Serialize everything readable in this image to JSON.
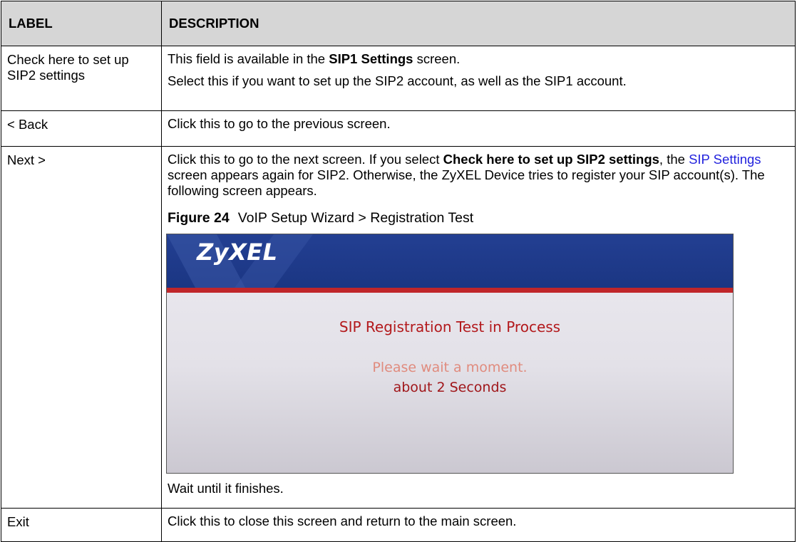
{
  "table": {
    "headers": {
      "label": "LABEL",
      "description": "DESCRIPTION"
    },
    "rows": [
      {
        "label": "Check here to set up SIP2 settings",
        "desc_line1_pre": "This field is available in the ",
        "desc_line1_bold": "SIP1 Settings",
        "desc_line1_post": " screen.",
        "desc_line2": "Select this if you want to set up the SIP2 account, as well as the SIP1 account."
      },
      {
        "label": "< Back",
        "desc": "Click this to go to the previous screen."
      },
      {
        "label": "Next >",
        "desc_pre": "Click this to go to the next screen. If you select ",
        "desc_bold": "Check here to set up SIP2 settings",
        "desc_mid": ", the ",
        "desc_link": "SIP Settings",
        "desc_post": " screen appears again for SIP2. Otherwise, the ZyXEL Device tries to register your SIP account(s). The following screen appears.",
        "figure_number": "Figure 24",
        "figure_title": "VoIP Setup Wizard > Registration Test",
        "after_figure": "Wait until it finishes."
      },
      {
        "label": "Exit",
        "desc": "Click this to close this screen and return to the main screen."
      }
    ]
  },
  "screenshot": {
    "logo_text": "ZyXEL",
    "title": "SIP Registration Test in Process",
    "wait_text": "Please wait a moment.",
    "seconds_text": "about 2 Seconds",
    "colors": {
      "banner": "#233f92",
      "red_rule": "#c0262a",
      "title_red": "#b3191c",
      "wait_pink": "#e08b7e",
      "header_gray": "#d6d6d6"
    }
  }
}
